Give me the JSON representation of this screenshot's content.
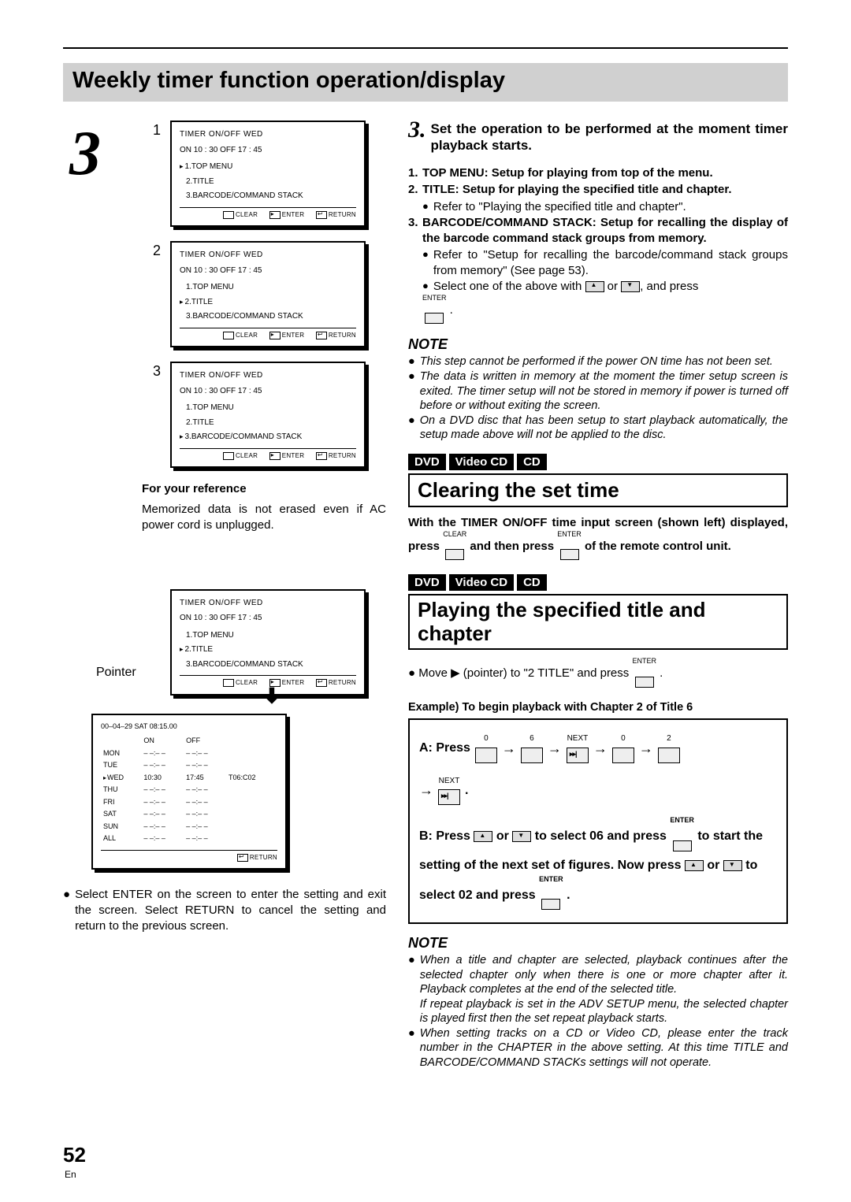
{
  "title": "Weekly timer function operation/display",
  "page_num": "52",
  "en": "En",
  "left": {
    "big3": "3",
    "osd": [
      {
        "num": "1",
        "hdr": "TIMER ON/OFF    WED",
        "times": "ON 10 : 30    OFF   17 : 45",
        "items": [
          {
            "ptr": true,
            "t": "1.TOP MENU"
          },
          {
            "ptr": false,
            "t": "2.TITLE"
          },
          {
            "ptr": false,
            "t": "3.BARCODE/COMMAND STACK"
          }
        ]
      },
      {
        "num": "2",
        "hdr": "TIMER ON/OFF    WED",
        "times": "ON 10 : 30    OFF   17 : 45",
        "items": [
          {
            "ptr": false,
            "t": "1.TOP MENU"
          },
          {
            "ptr": true,
            "t": "2.TITLE"
          },
          {
            "ptr": false,
            "t": "3.BARCODE/COMMAND STACK"
          }
        ]
      },
      {
        "num": "3",
        "hdr": "TIMER ON/OFF    WED",
        "times": "ON 10 : 30    OFF   17 : 45",
        "items": [
          {
            "ptr": false,
            "t": "1.TOP MENU"
          },
          {
            "ptr": false,
            "t": "2.TITLE"
          },
          {
            "ptr": true,
            "t": "3.BARCODE/COMMAND STACK"
          }
        ]
      }
    ],
    "footer": {
      "clear": "CLEAR",
      "enter": "ENTER",
      "return": "RETURN"
    },
    "for_your_ref_hdr": "For your reference",
    "for_your_ref": "Memorized data is not erased even if AC power cord is unplugged.",
    "pointer_label": "Pointer",
    "osd4": {
      "hdr": "TIMER ON/OFF    WED",
      "times": "ON 10 : 30    OFF   17 : 45",
      "items": [
        {
          "ptr": false,
          "t": "1.TOP MENU"
        },
        {
          "ptr": true,
          "t": "2.TITLE"
        },
        {
          "ptr": false,
          "t": "3.BARCODE/COMMAND STACK"
        }
      ]
    },
    "weekly": {
      "date": "00–04–29  SAT    08:15.00",
      "cols": [
        "ON",
        "OFF"
      ],
      "rows": [
        {
          "d": "MON",
          "on": "– –:– –",
          "off": "– –:– –",
          "ex": ""
        },
        {
          "d": "TUE",
          "on": "– –:– –",
          "off": "– –:– –",
          "ex": ""
        },
        {
          "d": "WED",
          "on": "10:30",
          "off": "17:45",
          "ex": "T06:C02",
          "ptr": true
        },
        {
          "d": "THU",
          "on": "– –:– –",
          "off": "– –:– –",
          "ex": ""
        },
        {
          "d": "FRI",
          "on": "– –:– –",
          "off": "– –:– –",
          "ex": ""
        },
        {
          "d": "SAT",
          "on": "– –:– –",
          "off": "– –:– –",
          "ex": ""
        },
        {
          "d": "SUN",
          "on": "– –:– –",
          "off": "– –:– –",
          "ex": ""
        },
        {
          "d": "ALL",
          "on": "– –:– –",
          "off": "– –:– –",
          "ex": ""
        }
      ],
      "return": "RETURN"
    },
    "below_weekly": "Select ENTER on the screen to enter the setting and exit the screen. Select RETURN to cancel the setting and return to the previous screen."
  },
  "right": {
    "step3_num": "3.",
    "step3_text": "Set the operation to be performed at the moment timer playback starts.",
    "items": [
      {
        "n": "1.",
        "bold": "TOP MENU: Setup for playing from top of the menu."
      },
      {
        "n": "2.",
        "bold": "TITLE: Setup for playing the specified title and chapter.",
        "bul": "Refer to \"Playing the specified title and chapter\"."
      },
      {
        "n": "3.",
        "bold": "BARCODE/COMMAND STACK: Setup for recalling the display of the barcode command stack groups from memory.",
        "bul": "Refer to \"Setup for recalling the barcode/command stack groups from memory\" (See page 53).",
        "bul2_a": "Select one of the above with ",
        "bul2_b": " or ",
        "bul2_c": ", and press",
        "enter": "ENTER"
      }
    ],
    "note_hdr": "NOTE",
    "notes1": [
      "This step cannot be performed if the power ON time has not been set.",
      "The data is written in memory at the moment the timer setup screen is exited. The timer setup will not be stored in memory if power is turned off before or without exiting the screen.",
      "On a DVD disc that has been setup to start playback automatically, the setup made above will not be applied to the disc."
    ],
    "chips": [
      "DVD",
      "Video CD",
      "CD"
    ],
    "sec1": "Clearing the set time",
    "clear_para_a": "With the TIMER ON/OFF time input screen (shown left) displayed, press ",
    "clear_lbl": "CLEAR",
    "clear_para_b": " and then press ",
    "enter_lbl": "ENTER",
    "clear_para_c": " of the remote control unit.",
    "sec2": "Playing the specified title and chapter",
    "move_a": "Move ",
    "move_b": " (pointer) to \"2 TITLE\" and press ",
    "move_enter": "ENTER",
    "example_hdr": "Example)   To begin playback with Chapter 2 of Title 6",
    "exA_label": "A: Press",
    "exA_nums": [
      "0",
      "6",
      "NEXT",
      "0",
      "2",
      "NEXT"
    ],
    "exB_a": "B: Press ",
    "exB_b": " or ",
    "exB_c": " to select 06 and press ",
    "exB_d": " to start the setting of the next set of figures. Now press ",
    "exB_e": " or ",
    "exB_f": " to select 02 and press ",
    "exB_g": ".",
    "notes2": [
      "When a title and chapter are selected, playback continues after the selected chapter only when there is one or more chapter after it. Playback completes at the end of the selected title.\nIf repeat playback is set in the ADV SETUP menu, the selected chapter is played first then the set repeat playback starts.",
      "When setting tracks on a CD or Video CD, please enter the track number in the CHAPTER in the above setting. At this time TITLE and BARCODE/COMMAND STACKs settings will not operate."
    ]
  }
}
